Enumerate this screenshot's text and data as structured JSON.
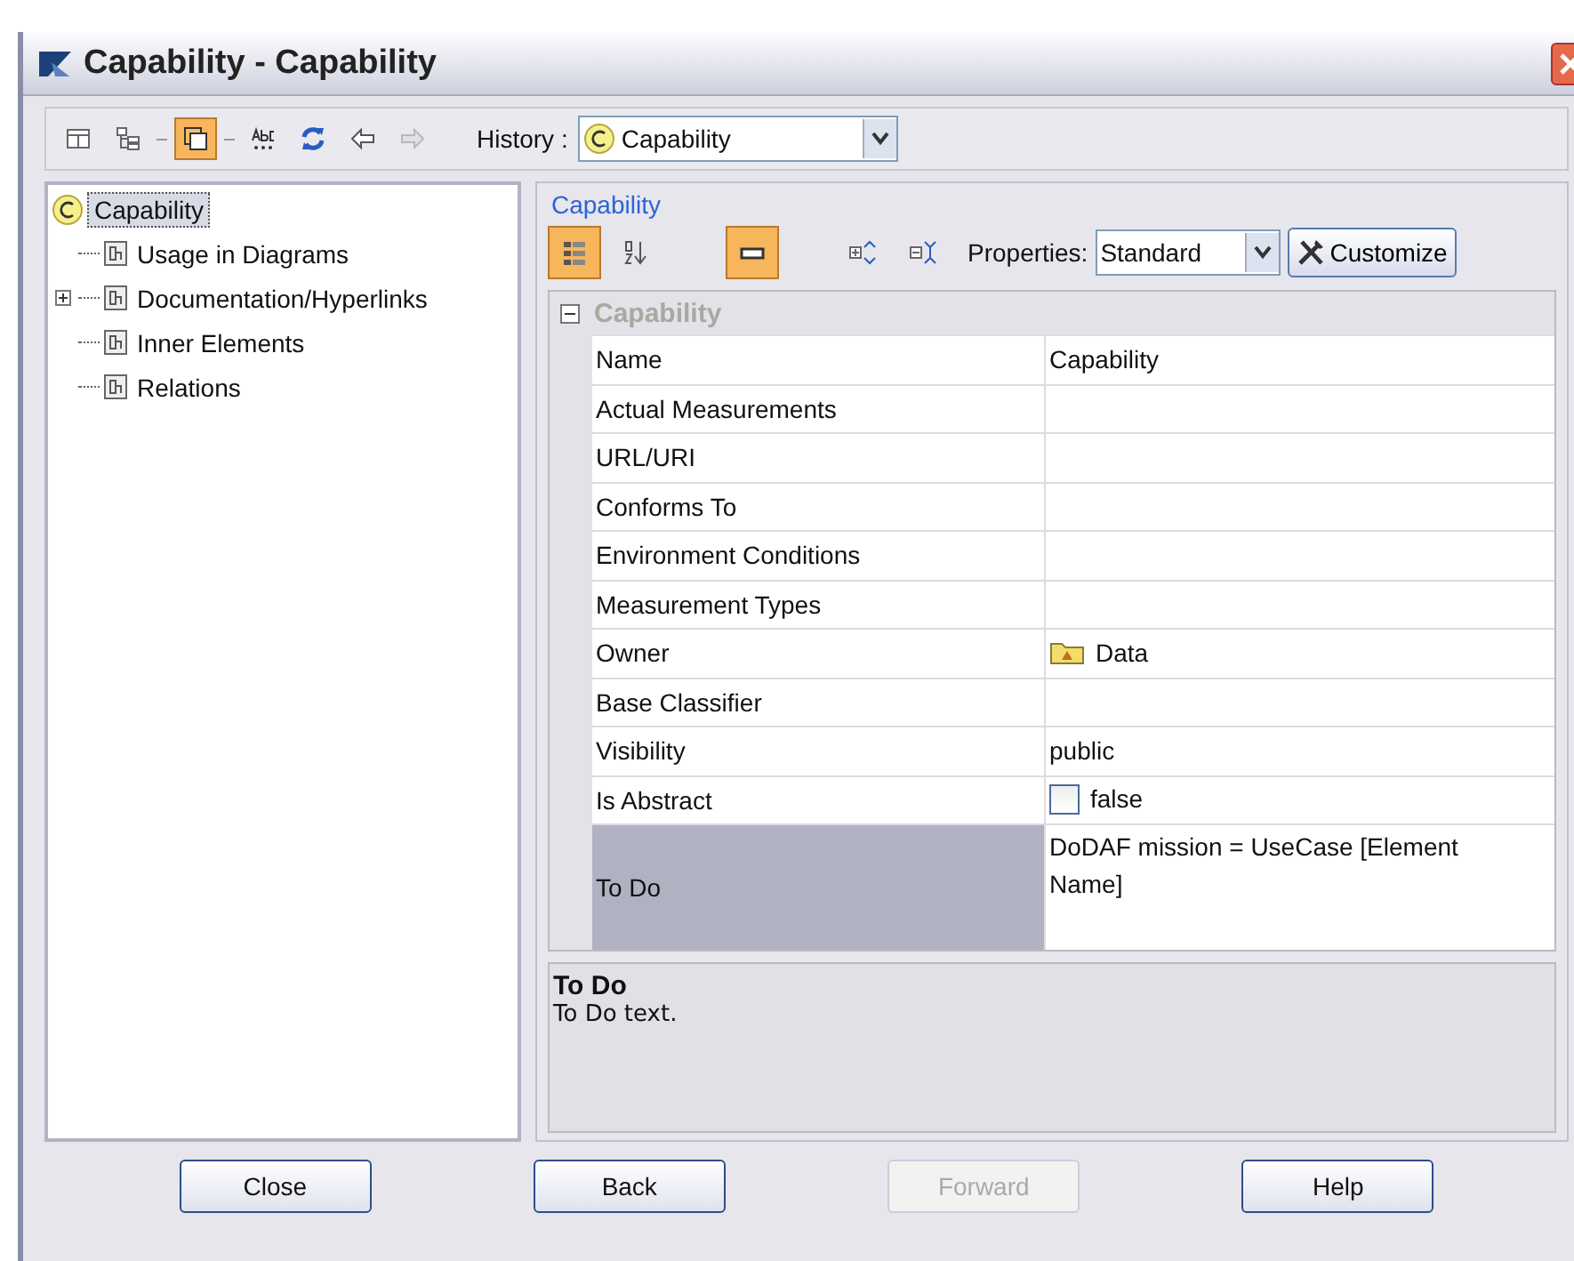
{
  "window": {
    "title": "Capability - Capability"
  },
  "toolbar": {
    "buttons": [
      {
        "kind": "table",
        "selected": false
      },
      {
        "kind": "tree",
        "selected": false
      },
      {
        "kind": "windows",
        "selected": true
      },
      {
        "kind": "spell",
        "selected": false
      },
      {
        "kind": "refresh",
        "selected": false
      },
      {
        "kind": "back",
        "selected": false,
        "disabled": false
      },
      {
        "kind": "forward",
        "selected": false,
        "disabled": true
      }
    ],
    "history_label": "History :",
    "history_value": "Capability"
  },
  "tree": {
    "root": "Capability",
    "selected": true,
    "children": [
      {
        "label": "Usage in Diagrams",
        "expandable": false
      },
      {
        "label": "Documentation/Hyperlinks",
        "expandable": true
      },
      {
        "label": "Inner Elements",
        "expandable": false
      },
      {
        "label": "Relations",
        "expandable": false
      }
    ]
  },
  "panel": {
    "title": "Capability",
    "tools": [
      {
        "kind": "categorized",
        "selected": true
      },
      {
        "kind": "sort",
        "selected": false
      },
      {
        "kind": "compact",
        "selected": true
      },
      {
        "kind": "expand",
        "selected": false
      },
      {
        "kind": "collapse",
        "selected": false
      }
    ],
    "properties_label": "Properties:",
    "properties_value": "Standard",
    "customize": "Customize",
    "group": "Capability",
    "rows": [
      {
        "name": "Name",
        "value": "Capability",
        "kind": "text",
        "selected": false
      },
      {
        "name": "Actual Measurements",
        "kind": "text",
        "selected": false
      },
      {
        "name": "URL/URI",
        "kind": "text",
        "selected": false
      },
      {
        "name": "Conforms To",
        "kind": "text",
        "selected": false
      },
      {
        "name": "Environment Conditions",
        "kind": "text",
        "selected": false
      },
      {
        "name": "Measurement Types",
        "kind": "text",
        "selected": false
      },
      {
        "name": "Owner",
        "value": "Data",
        "kind": "owner",
        "selected": false
      },
      {
        "name": "Base Classifier",
        "kind": "text",
        "selected": false
      },
      {
        "name": "Visibility",
        "value": "public",
        "kind": "text",
        "selected": false
      },
      {
        "name": "Is Abstract",
        "value": "false",
        "kind": "checkbox",
        "checked": false,
        "selected": false
      },
      {
        "name": "To Do",
        "value": "DoDAF mission = UseCase [Element Name]",
        "kind": "multiline",
        "selected": true
      }
    ],
    "description_title": "To Do",
    "description_text": "To Do text."
  },
  "buttons": [
    {
      "label": "Close",
      "disabled": false
    },
    {
      "label": "Back",
      "disabled": false
    },
    {
      "label": "Forward",
      "disabled": true
    },
    {
      "label": "Help",
      "disabled": false
    }
  ]
}
